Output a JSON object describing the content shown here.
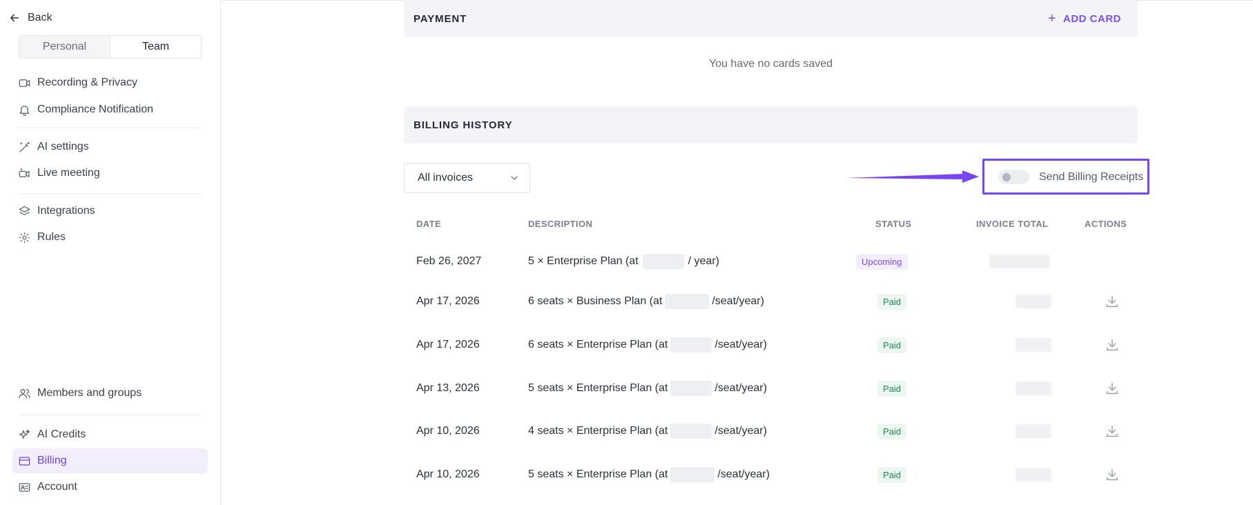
{
  "sidebar": {
    "back_label": "Back",
    "tabs": [
      "Personal",
      "Team"
    ],
    "items": [
      {
        "label": "Recording & Privacy",
        "icon": "video-icon"
      },
      {
        "label": "Compliance Notification",
        "icon": "bell-icon"
      },
      {
        "label": "AI settings",
        "icon": "magic-wand-icon"
      },
      {
        "label": "Live meeting",
        "icon": "video-sparkle-icon"
      },
      {
        "label": "Integrations",
        "icon": "layers-icon"
      },
      {
        "label": "Rules",
        "icon": "gear-check-icon"
      },
      {
        "label": "Members and groups",
        "icon": "users-icon"
      },
      {
        "label": "AI Credits",
        "icon": "sparkles-icon"
      },
      {
        "label": "Billing",
        "icon": "credit-card-icon",
        "active": true
      },
      {
        "label": "Account",
        "icon": "id-card-icon"
      }
    ]
  },
  "payment": {
    "title": "PAYMENT",
    "add_card_label": "ADD CARD",
    "empty_text": "You have no cards saved"
  },
  "billing": {
    "title": "BILLING HISTORY",
    "filter_value": "All invoices",
    "toggle_label": "Send Billing Receipts",
    "toggle_on": false,
    "columns": [
      "DATE",
      "DESCRIPTION",
      "STATUS",
      "INVOICE TOTAL",
      "ACTIONS"
    ],
    "rows": [
      {
        "date": "Feb 26, 2027",
        "desc_pre": "5 × Enterprise Plan (at",
        "desc_post": "/ year)",
        "status": "Upcoming"
      },
      {
        "date": "Apr 17, 2026",
        "desc_pre": "6 seats × Business Plan (at",
        "desc_post": "/seat/year)",
        "status": "Paid"
      },
      {
        "date": "Apr 17, 2026",
        "desc_pre": "6 seats × Enterprise Plan (at",
        "desc_post": "/seat/year)",
        "status": "Paid"
      },
      {
        "date": "Apr 13, 2026",
        "desc_pre": "5 seats × Enterprise Plan (at",
        "desc_post": "/seat/year)",
        "status": "Paid"
      },
      {
        "date": "Apr 10, 2026",
        "desc_pre": "4 seats × Enterprise Plan (at",
        "desc_post": "/seat/year)",
        "status": "Paid"
      },
      {
        "date": "Apr 10, 2026",
        "desc_pre": "5 seats × Enterprise Plan (at",
        "desc_post": "/seat/year)",
        "status": "Paid"
      }
    ]
  },
  "colors": {
    "accent": "#7a4fef",
    "highlight_border": "#7745f5",
    "paid_text": "#1e8a4e"
  }
}
